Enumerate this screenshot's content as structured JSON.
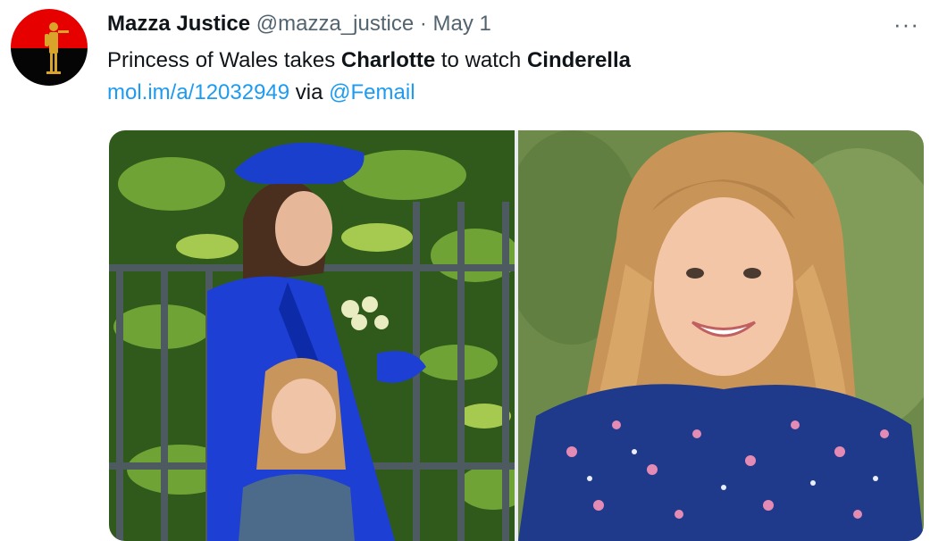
{
  "tweet": {
    "author_name": "Mazza Justice",
    "handle": "@mazza_justice",
    "separator": "·",
    "date": "May 1",
    "more_label": "···",
    "text": {
      "part1": "Princess of Wales takes ",
      "bold1": "Charlotte",
      "part2": " to watch ",
      "bold2": "Cinderella"
    },
    "link_url": "mol.im/a/12032949",
    "via_text": " via ",
    "mention": "@Femail"
  },
  "icons": {
    "avatar": "red-black-flag-soldier-avatar",
    "more": "more-options-icon"
  },
  "colors": {
    "link": "#1d9bf0",
    "text": "#0f1419",
    "secondary": "#536471"
  }
}
